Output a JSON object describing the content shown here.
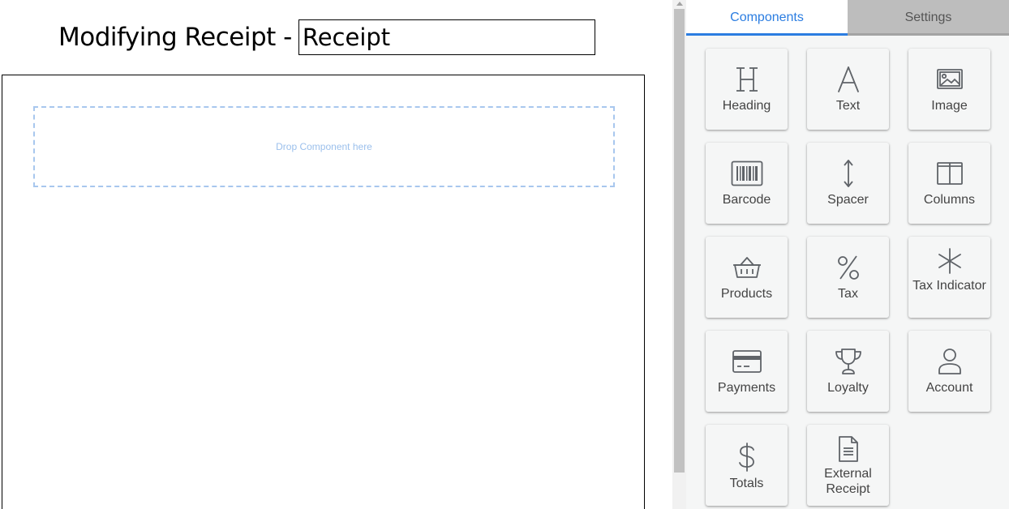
{
  "editor": {
    "title_prefix": "Modifying Receipt -",
    "name_value": "Receipt",
    "dropzone_text": "Drop Component here"
  },
  "tabs": [
    {
      "label": "Components",
      "active": true
    },
    {
      "label": "Settings",
      "active": false
    }
  ],
  "components": [
    {
      "label": "Heading",
      "icon": "heading-icon"
    },
    {
      "label": "Text",
      "icon": "text-icon"
    },
    {
      "label": "Image",
      "icon": "image-icon"
    },
    {
      "label": "Barcode",
      "icon": "barcode-icon"
    },
    {
      "label": "Spacer",
      "icon": "spacer-icon"
    },
    {
      "label": "Columns",
      "icon": "columns-icon"
    },
    {
      "label": "Products",
      "icon": "basket-icon"
    },
    {
      "label": "Tax",
      "icon": "percent-icon"
    },
    {
      "label": "Tax Indicator",
      "icon": "asterisk-icon"
    },
    {
      "label": "Payments",
      "icon": "credit-card-icon"
    },
    {
      "label": "Loyalty",
      "icon": "trophy-icon"
    },
    {
      "label": "Account",
      "icon": "user-icon"
    },
    {
      "label": "Totals",
      "icon": "dollar-icon"
    },
    {
      "label": "External Receipt",
      "icon": "document-icon"
    }
  ],
  "colors": {
    "accent": "#2b7de1",
    "inactive_tab": "#bdbdbd",
    "dropzone_border": "#a8c7ee",
    "icon": "#5f6368"
  }
}
